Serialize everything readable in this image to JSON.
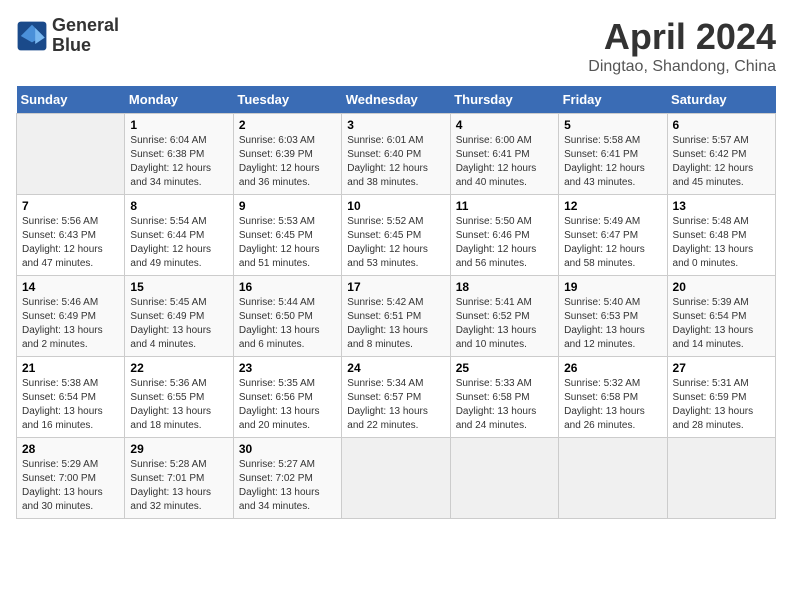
{
  "logo": {
    "line1": "General",
    "line2": "Blue"
  },
  "title": "April 2024",
  "subtitle": "Dingtao, Shandong, China",
  "days_of_week": [
    "Sunday",
    "Monday",
    "Tuesday",
    "Wednesday",
    "Thursday",
    "Friday",
    "Saturday"
  ],
  "weeks": [
    [
      {
        "day": "",
        "info": ""
      },
      {
        "day": "1",
        "info": "Sunrise: 6:04 AM\nSunset: 6:38 PM\nDaylight: 12 hours\nand 34 minutes."
      },
      {
        "day": "2",
        "info": "Sunrise: 6:03 AM\nSunset: 6:39 PM\nDaylight: 12 hours\nand 36 minutes."
      },
      {
        "day": "3",
        "info": "Sunrise: 6:01 AM\nSunset: 6:40 PM\nDaylight: 12 hours\nand 38 minutes."
      },
      {
        "day": "4",
        "info": "Sunrise: 6:00 AM\nSunset: 6:41 PM\nDaylight: 12 hours\nand 40 minutes."
      },
      {
        "day": "5",
        "info": "Sunrise: 5:58 AM\nSunset: 6:41 PM\nDaylight: 12 hours\nand 43 minutes."
      },
      {
        "day": "6",
        "info": "Sunrise: 5:57 AM\nSunset: 6:42 PM\nDaylight: 12 hours\nand 45 minutes."
      }
    ],
    [
      {
        "day": "7",
        "info": "Sunrise: 5:56 AM\nSunset: 6:43 PM\nDaylight: 12 hours\nand 47 minutes."
      },
      {
        "day": "8",
        "info": "Sunrise: 5:54 AM\nSunset: 6:44 PM\nDaylight: 12 hours\nand 49 minutes."
      },
      {
        "day": "9",
        "info": "Sunrise: 5:53 AM\nSunset: 6:45 PM\nDaylight: 12 hours\nand 51 minutes."
      },
      {
        "day": "10",
        "info": "Sunrise: 5:52 AM\nSunset: 6:45 PM\nDaylight: 12 hours\nand 53 minutes."
      },
      {
        "day": "11",
        "info": "Sunrise: 5:50 AM\nSunset: 6:46 PM\nDaylight: 12 hours\nand 56 minutes."
      },
      {
        "day": "12",
        "info": "Sunrise: 5:49 AM\nSunset: 6:47 PM\nDaylight: 12 hours\nand 58 minutes."
      },
      {
        "day": "13",
        "info": "Sunrise: 5:48 AM\nSunset: 6:48 PM\nDaylight: 13 hours\nand 0 minutes."
      }
    ],
    [
      {
        "day": "14",
        "info": "Sunrise: 5:46 AM\nSunset: 6:49 PM\nDaylight: 13 hours\nand 2 minutes."
      },
      {
        "day": "15",
        "info": "Sunrise: 5:45 AM\nSunset: 6:49 PM\nDaylight: 13 hours\nand 4 minutes."
      },
      {
        "day": "16",
        "info": "Sunrise: 5:44 AM\nSunset: 6:50 PM\nDaylight: 13 hours\nand 6 minutes."
      },
      {
        "day": "17",
        "info": "Sunrise: 5:42 AM\nSunset: 6:51 PM\nDaylight: 13 hours\nand 8 minutes."
      },
      {
        "day": "18",
        "info": "Sunrise: 5:41 AM\nSunset: 6:52 PM\nDaylight: 13 hours\nand 10 minutes."
      },
      {
        "day": "19",
        "info": "Sunrise: 5:40 AM\nSunset: 6:53 PM\nDaylight: 13 hours\nand 12 minutes."
      },
      {
        "day": "20",
        "info": "Sunrise: 5:39 AM\nSunset: 6:54 PM\nDaylight: 13 hours\nand 14 minutes."
      }
    ],
    [
      {
        "day": "21",
        "info": "Sunrise: 5:38 AM\nSunset: 6:54 PM\nDaylight: 13 hours\nand 16 minutes."
      },
      {
        "day": "22",
        "info": "Sunrise: 5:36 AM\nSunset: 6:55 PM\nDaylight: 13 hours\nand 18 minutes."
      },
      {
        "day": "23",
        "info": "Sunrise: 5:35 AM\nSunset: 6:56 PM\nDaylight: 13 hours\nand 20 minutes."
      },
      {
        "day": "24",
        "info": "Sunrise: 5:34 AM\nSunset: 6:57 PM\nDaylight: 13 hours\nand 22 minutes."
      },
      {
        "day": "25",
        "info": "Sunrise: 5:33 AM\nSunset: 6:58 PM\nDaylight: 13 hours\nand 24 minutes."
      },
      {
        "day": "26",
        "info": "Sunrise: 5:32 AM\nSunset: 6:58 PM\nDaylight: 13 hours\nand 26 minutes."
      },
      {
        "day": "27",
        "info": "Sunrise: 5:31 AM\nSunset: 6:59 PM\nDaylight: 13 hours\nand 28 minutes."
      }
    ],
    [
      {
        "day": "28",
        "info": "Sunrise: 5:29 AM\nSunset: 7:00 PM\nDaylight: 13 hours\nand 30 minutes."
      },
      {
        "day": "29",
        "info": "Sunrise: 5:28 AM\nSunset: 7:01 PM\nDaylight: 13 hours\nand 32 minutes."
      },
      {
        "day": "30",
        "info": "Sunrise: 5:27 AM\nSunset: 7:02 PM\nDaylight: 13 hours\nand 34 minutes."
      },
      {
        "day": "",
        "info": ""
      },
      {
        "day": "",
        "info": ""
      },
      {
        "day": "",
        "info": ""
      },
      {
        "day": "",
        "info": ""
      }
    ]
  ]
}
